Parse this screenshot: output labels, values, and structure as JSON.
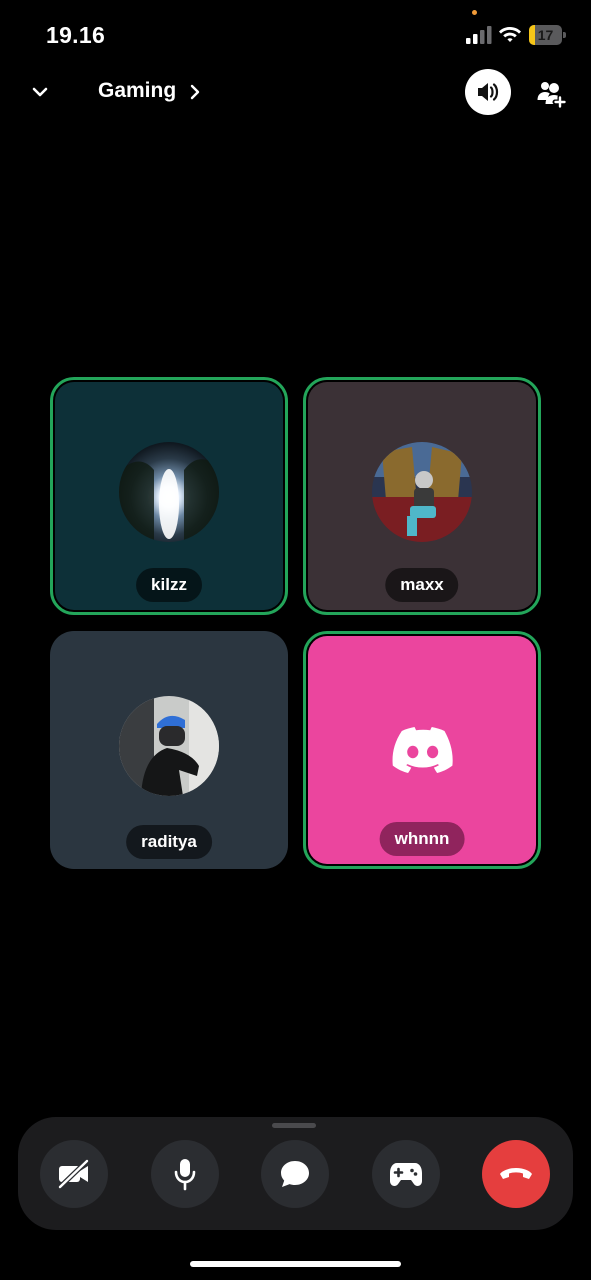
{
  "status_bar": {
    "time": "19.16",
    "battery": "17",
    "battery_level_percent": 17
  },
  "header": {
    "channel_title": "Gaming"
  },
  "participants": [
    {
      "name": "kilzz",
      "speaking": true,
      "tile_color": "#0d3038"
    },
    {
      "name": "maxx",
      "speaking": true,
      "tile_color": "#3b3136"
    },
    {
      "name": "raditya",
      "speaking": false,
      "tile_color": "#2b3640"
    },
    {
      "name": "whnnn",
      "speaking": true,
      "tile_color": "#eb459e"
    }
  ],
  "controls": [
    "camera-off",
    "microphone",
    "chat",
    "activities",
    "end-call"
  ],
  "colors": {
    "speaking_border": "#23a55a",
    "end_call": "#e53e3e",
    "brand_pink": "#eb459e"
  }
}
